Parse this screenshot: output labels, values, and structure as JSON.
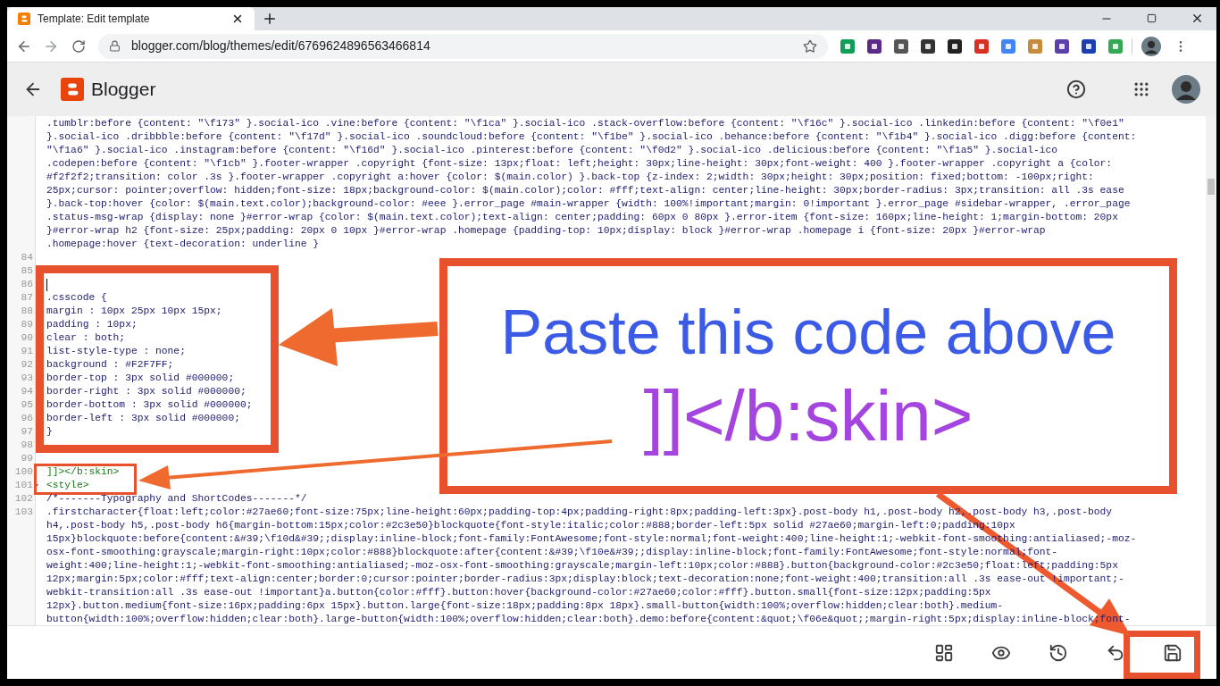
{
  "browser": {
    "tab": {
      "title": "Template: Edit template",
      "selected": true
    },
    "url": "blogger.com/blog/themes/edit/6769624896563466814"
  },
  "app": {
    "name": "Blogger"
  },
  "editor": {
    "continued_lines": [
      ".tumblr:before {content: \"\\f173\" }.social-ico .vine:before {content: \"\\f1ca\" }.social-ico .stack-overflow:before {content: \"\\f16c\" }.social-ico .linkedin:before {content: \"\\f0e1\"",
      "}.social-ico .dribbble:before {content: \"\\f17d\" }.social-ico .soundcloud:before {content: \"\\f1be\" }.social-ico .behance:before {content: \"\\f1b4\" }.social-ico .digg:before {content:",
      "\"\\f1a6\" }.social-ico .instagram:before {content: \"\\f16d\" }.social-ico .pinterest:before {content: \"\\f0d2\" }.social-ico .delicious:before {content: \"\\f1a5\" }.social-ico",
      ".codepen:before {content: \"\\f1cb\" }.footer-wrapper .copyright {font-size: 13px;float: left;height: 30px;line-height: 30px;font-weight: 400 }.footer-wrapper .copyright a {color:",
      "#f2f2f2;transition: color .3s }.footer-wrapper .copyright a:hover {color: $(main.color) }.back-top {z-index: 2;width: 30px;height: 30px;position: fixed;bottom: -100px;right:",
      "25px;cursor: pointer;overflow: hidden;font-size: 18px;background-color: $(main.color);color: #fff;text-align: center;line-height: 30px;border-radius: 3px;transition: all .3s ease",
      "}.back-top:hover {color: $(main.text.color);background-color: #eee }.error_page #main-wrapper {width: 100%!important;margin: 0!important }.error_page #sidebar-wrapper, .error_page",
      ".status-msg-wrap {display: none }#error-wrap {color: $(main.text.color);text-align: center;padding: 60px 0 80px }.error-item {font-size: 160px;line-height: 1;margin-bottom: 20px",
      "}#error-wrap h2 {font-size: 25px;padding: 20px 0 10px }#error-wrap .homepage {padding-top: 10px;display: block }#error-wrap .homepage i {font-size: 20px }#error-wrap",
      ".homepage:hover {text-decoration: underline }"
    ],
    "lines": [
      {
        "number": "84",
        "cursor": false,
        "foldable": false
      },
      {
        "number": "85",
        "cursor": false,
        "foldable": false
      },
      {
        "number": "86",
        "cursor": true,
        "foldable": false
      },
      {
        "number": "87",
        "kind": "css",
        "text": [
          ".csscode {"
        ],
        "cursor": false,
        "foldable": false
      },
      {
        "number": "88",
        "kind": "css",
        "text": [
          "margin : 10px 25px 10px 15px;"
        ],
        "cursor": false,
        "foldable": false
      },
      {
        "number": "89",
        "kind": "css",
        "text": [
          "padding : 10px;"
        ],
        "cursor": false,
        "foldable": false
      },
      {
        "number": "90",
        "kind": "css",
        "text": [
          "clear : both;"
        ],
        "cursor": false,
        "foldable": false
      },
      {
        "number": "91",
        "kind": "css",
        "text": [
          "list-style-type : none;"
        ],
        "cursor": false,
        "foldable": false
      },
      {
        "number": "92",
        "kind": "css",
        "text": [
          "background : #F2F7FF;"
        ],
        "cursor": false,
        "foldable": false
      },
      {
        "number": "93",
        "kind": "css",
        "text": [
          "border-top : 3px solid #000000;"
        ],
        "cursor": false,
        "foldable": false
      },
      {
        "number": "94",
        "kind": "css",
        "text": [
          "border-right : 3px solid #000000;"
        ],
        "cursor": false,
        "foldable": false
      },
      {
        "number": "95",
        "kind": "css",
        "text": [
          "border-bottom : 3px solid #000000;"
        ],
        "cursor": false,
        "foldable": false
      },
      {
        "number": "96",
        "kind": "css",
        "text": [
          "border-left : 3px solid #000000;"
        ],
        "cursor": false,
        "foldable": false
      },
      {
        "number": "97",
        "kind": "css",
        "text": [
          "}"
        ],
        "cursor": false,
        "foldable": false
      },
      {
        "number": "98",
        "cursor": false,
        "foldable": false
      },
      {
        "number": "99",
        "cursor": false,
        "foldable": false
      },
      {
        "number": "100",
        "kind": "tag",
        "text": [
          "]]></b:skin>"
        ],
        "cursor": false,
        "foldable": false
      },
      {
        "number": "101",
        "kind": "tag",
        "text": [
          "<style>"
        ],
        "cursor": false,
        "foldable": true
      },
      {
        "number": "102",
        "kind": "css",
        "text": [
          "/*-------Typography and ShortCodes-------*/"
        ],
        "cursor": false,
        "foldable": false
      },
      {
        "number": "103",
        "kind": "css",
        "text": [
          ".firstcharacter{float:left;color:#27ae60;font-size:75px;line-height:60px;padding-top:4px;padding-right:8px;padding-left:3px}.post-body h1,.post-body h2,.post-body h3,.post-body",
          "h4,.post-body h5,.post-body h6{margin-bottom:15px;color:#2c3e50}blockquote{font-style:italic;color:#888;border-left:5px solid #27ae60;margin-left:0;padding:10px",
          "15px}blockquote:before{content:&#39;\\f10d&#39;;display:inline-block;font-family:FontAwesome;font-style:normal;font-weight:400;line-height:1;-webkit-font-smoothing:antialiased;-moz-",
          "osx-font-smoothing:grayscale;margin-right:10px;color:#888}blockquote:after{content:&#39;\\f10e&#39;;display:inline-block;font-family:FontAwesome;font-style:normal;font-",
          "weight:400;line-height:1;-webkit-font-smoothing:antialiased;-moz-osx-font-smoothing:grayscale;margin-left:10px;color:#888}.button{background-color:#2c3e50;float:left;padding:5px",
          "12px;margin:5px;color:#fff;text-align:center;border:0;cursor:pointer;border-radius:3px;display:block;text-decoration:none;font-weight:400;transition:all .3s ease-out !important;-",
          "webkit-transition:all .3s ease-out !important}a.button{color:#fff}.button:hover{background-color:#27ae60;color:#fff}.button.small{font-size:12px;padding:5px",
          "12px}.button.medium{font-size:16px;padding:6px 15px}.button.large{font-size:18px;padding:8px 18px}.small-button{width:100%;overflow:hidden;clear:both}.medium-",
          "button{width:100%;overflow:hidden;clear:both}.large-button{width:100%;overflow:hidden;clear:both}.demo:before{content:&quot;\\f06e&quot;;margin-right:5px;display:inline-block;font-"
        ],
        "cursor": false,
        "foldable": false
      }
    ]
  },
  "annotation": {
    "lines": [
      "Paste this code above",
      "]]</b:skin>"
    ]
  }
}
